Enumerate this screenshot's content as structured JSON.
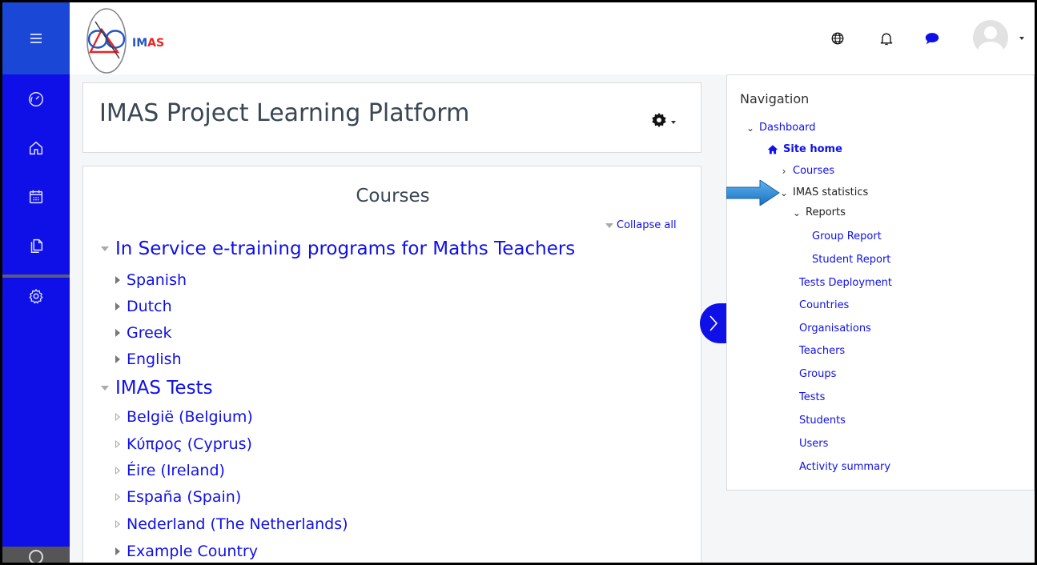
{
  "header": {
    "logo_text_prefix": "IM",
    "logo_text_suffix": "AS",
    "icons": [
      "globe-icon",
      "bell-icon",
      "chat-icon",
      "avatar"
    ]
  },
  "rail": {
    "icons": [
      "dashboard-icon",
      "home-icon",
      "calendar-icon",
      "files-icon",
      "settings-icon"
    ]
  },
  "page": {
    "title": "IMAS Project Learning Platform"
  },
  "courses": {
    "heading": "Courses",
    "collapse_label": "Collapse all",
    "categories": [
      {
        "label": "In Service e-training programs for Maths Teachers",
        "items": [
          "Spanish",
          "Dutch",
          "Greek",
          "English"
        ]
      },
      {
        "label": "IMAS Tests",
        "items": [
          "België (Belgium)",
          "Κύπρος (Cyprus)",
          "Éire (Ireland)",
          "España (Spain)",
          "Nederland (The Netherlands)",
          "Example Country"
        ]
      }
    ]
  },
  "navigation": {
    "title": "Navigation",
    "dashboard": "Dashboard",
    "site_home": "Site home",
    "courses": "Courses",
    "imas_statistics": "IMAS statistics",
    "reports": "Reports",
    "group_report": "Group Report",
    "student_report": "Student Report",
    "links": [
      "Tests Deployment",
      "Countries",
      "Organisations",
      "Teachers",
      "Groups",
      "Tests",
      "Students",
      "Users",
      "Activity summary"
    ]
  },
  "colors": {
    "rail": "#0f10e8",
    "link": "#0f10e8",
    "arrow": "#1f87d6"
  }
}
